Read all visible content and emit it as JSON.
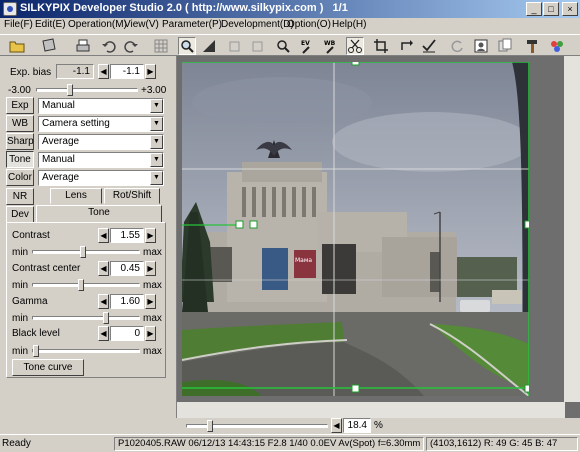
{
  "window": {
    "title": "SILKYPIX Developer Studio 2.0 ( http://www.silkypix.com )   1/1",
    "minimize": "_",
    "maximize": "□",
    "close": "×"
  },
  "menu": [
    "File(F)",
    "Edit(E)",
    "Operation(M)",
    "View(V)",
    "Parameter(P)",
    "Development(D)",
    "Option(O)",
    "Help(H)"
  ],
  "left_panel": {
    "exp_bias": {
      "label": "Exp. bias",
      "current": "-1.1",
      "value": "-1.1",
      "min": "-3.00",
      "max": "+3.00",
      "level_fraction": 0.32
    },
    "params": [
      {
        "button": "Exp",
        "value": "Manual"
      },
      {
        "button": "WB",
        "value": "Camera setting"
      },
      {
        "button": "Sharp",
        "value": "Average"
      },
      {
        "button": "Tone",
        "value": "Manual"
      },
      {
        "button": "Color",
        "value": "Average"
      }
    ],
    "nr_button": "NR",
    "dev_button": "Dev",
    "tabs": [
      "Lens",
      "Rot/Shift",
      "Tone"
    ],
    "sliders": [
      {
        "label": "Contrast",
        "value": "1.55",
        "min": "min",
        "max": "max",
        "level_fraction": 0.47
      },
      {
        "label": "Contrast center",
        "value": "0.45",
        "min": "min",
        "max": "max",
        "level_fraction": 0.45
      },
      {
        "label": "Gamma",
        "value": "1.60",
        "min": "min",
        "max": "max",
        "level_fraction": 0.7
      },
      {
        "label": "Black level",
        "value": "0",
        "min": "min",
        "max": "max",
        "level_fraction": 0.0
      }
    ],
    "tone_curve_button": "Tone curve"
  },
  "zoom": {
    "value": "18.4",
    "unit": "%"
  },
  "status": {
    "ready": "Ready",
    "info": "P1020405.RAW 06/12/13 14:43:15 F2.8 1/40 0.0EV Av(Spot) f=6.30mm",
    "pixel": "(4103,1612) R: 49 G: 45 B: 47"
  },
  "photo_poster_text": "Мама",
  "icons": [
    "open-folder-icon",
    "save-icon",
    "print-icon",
    "undo-icon",
    "redo-icon",
    "grid-icon",
    "zoom-tool-icon",
    "crop-tool-icon",
    "rotate-left-icon",
    "rotate-right-icon",
    "magnifier-icon",
    "ev-picker-icon",
    "wb-picker-icon",
    "scissors-icon",
    "crop-ratio-icon",
    "rotate-cw-icon",
    "check-icon",
    "refresh-icon",
    "portrait-icon",
    "copy-icon",
    "hammer-icon",
    "settings-icon"
  ]
}
